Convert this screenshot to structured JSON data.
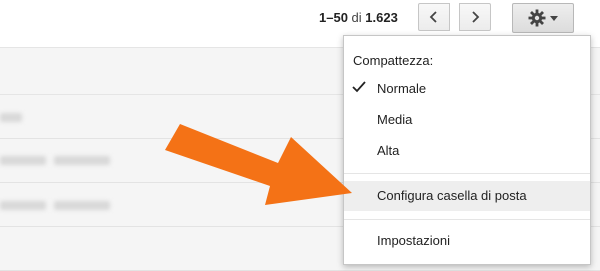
{
  "toolbar": {
    "pager": {
      "range": "1–50",
      "of": "di",
      "total": "1.623"
    },
    "prev_icon": "chevron-left-icon",
    "next_icon": "chevron-right-icon",
    "settings_icon": "gear-icon"
  },
  "menu": {
    "density_label": "Compattezza:",
    "density_options": [
      {
        "label": "Normale",
        "selected": true
      },
      {
        "label": "Media",
        "selected": false
      },
      {
        "label": "Alta",
        "selected": false
      }
    ],
    "configure_inbox": "Configura casella di posta",
    "settings": "Impostazioni"
  },
  "colors": {
    "arrow": "#f47216",
    "hover": "#eeeeee"
  }
}
